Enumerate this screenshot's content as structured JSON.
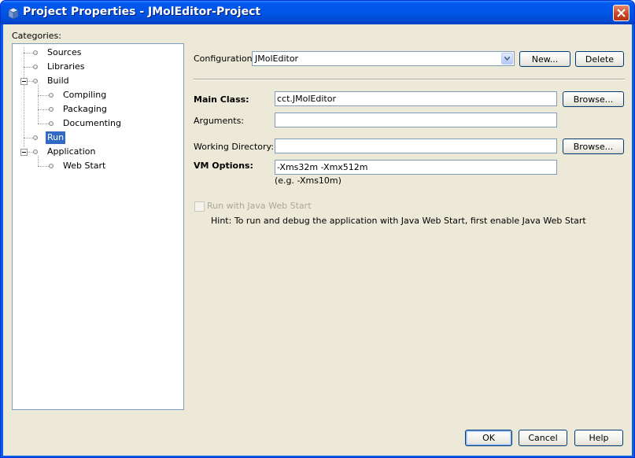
{
  "window": {
    "title": "Project Properties - JMolEditor-Project"
  },
  "categories": {
    "label": "Categories:",
    "items": [
      {
        "label": "Sources"
      },
      {
        "label": "Libraries"
      },
      {
        "label": "Build"
      },
      {
        "label": "Compiling"
      },
      {
        "label": "Packaging"
      },
      {
        "label": "Documenting"
      },
      {
        "label": "Run",
        "selected": true
      },
      {
        "label": "Application"
      },
      {
        "label": "Web Start"
      }
    ]
  },
  "configuration": {
    "label": "Configuration:",
    "value": "JMolEditor",
    "new_button": "New...",
    "delete_button": "Delete"
  },
  "run": {
    "main_class_label": "Main Class:",
    "main_class_value": "cct.JMolEditor",
    "browse_button": "Browse...",
    "arguments_label": "Arguments:",
    "arguments_value": "",
    "working_dir_label": "Working Directory:",
    "working_dir_value": "",
    "working_dir_browse": "Browse...",
    "vm_options_label": "VM Options:",
    "vm_options_value": "-Xms32m -Xmx512m",
    "vm_options_hint": "(e.g. -Xms10m)",
    "web_start_checkbox": "Run with Java Web Start",
    "hint": "Hint: To run and debug the application with Java Web Start, first enable Java Web Start"
  },
  "buttons": {
    "ok": "OK",
    "cancel": "Cancel",
    "help": "Help"
  },
  "colors": {
    "selection": "#316ac5",
    "title_bar": "#0055e6",
    "dialog_bg": "#ece9d8"
  }
}
